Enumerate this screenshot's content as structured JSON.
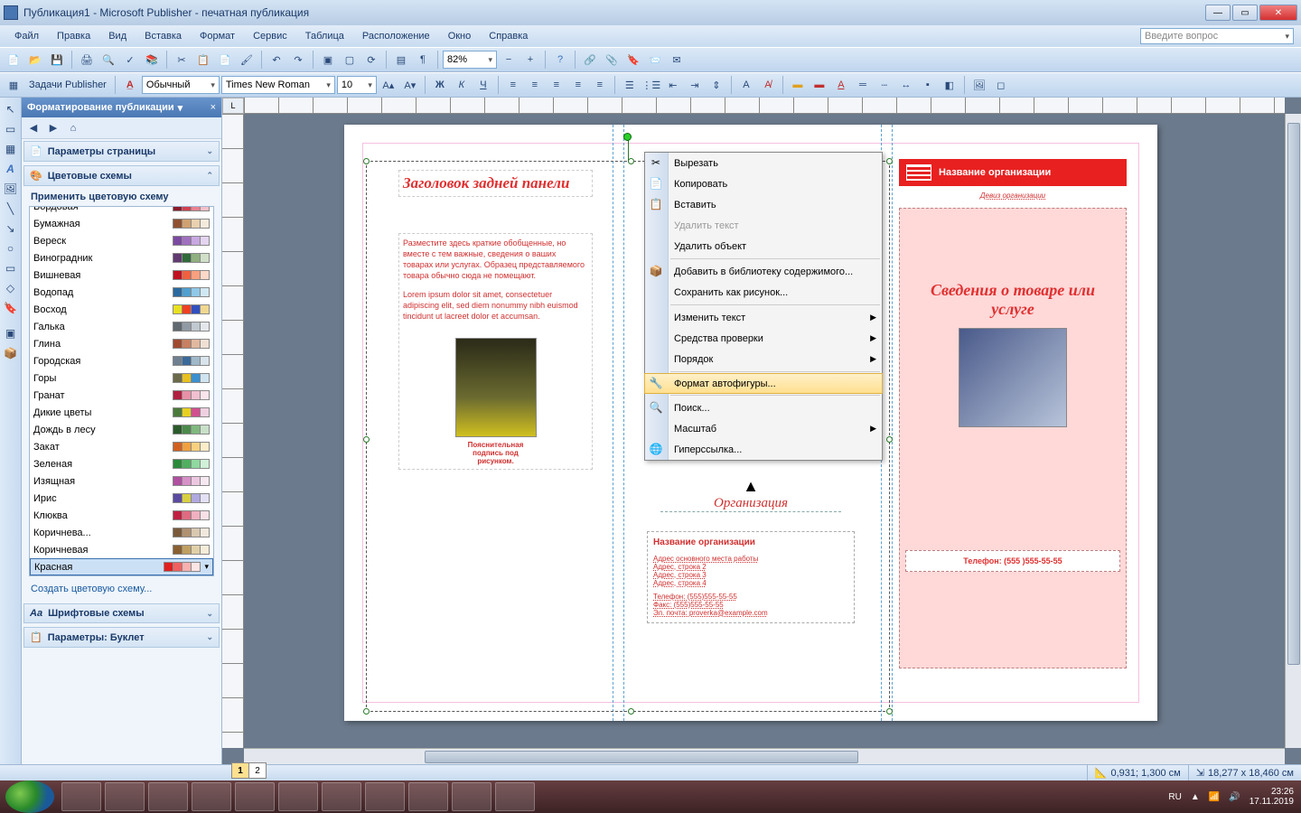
{
  "window": {
    "title": "Публикация1 - Microsoft Publisher - печатная публикация"
  },
  "menu": {
    "items": [
      "Файл",
      "Правка",
      "Вид",
      "Вставка",
      "Формат",
      "Сервис",
      "Таблица",
      "Расположение",
      "Окно",
      "Справка"
    ],
    "ask": "Введите вопрос"
  },
  "toolbar2": {
    "tasks_label": "Задачи Publisher",
    "style": "Обычный",
    "font": "Times New Roman",
    "size": "10",
    "zoom": "82%"
  },
  "taskpane": {
    "title": "Форматирование публикации",
    "sec_page": "Параметры страницы",
    "sec_color": "Цветовые схемы",
    "apply_label": "Применить цветовую схему",
    "schemes": [
      {
        "name": "Бордовая",
        "c": [
          "#8a1a2a",
          "#d04050",
          "#e88090",
          "#f4c0c8"
        ]
      },
      {
        "name": "Бумажная",
        "c": [
          "#905030",
          "#d0a070",
          "#e8d0b0",
          "#f4eadc"
        ]
      },
      {
        "name": "Вереск",
        "c": [
          "#7a4aa0",
          "#a070c0",
          "#c8a8e0",
          "#e4d4f0"
        ]
      },
      {
        "name": "Виноградник",
        "c": [
          "#603a70",
          "#306a3a",
          "#90b080",
          "#d0e0c8"
        ]
      },
      {
        "name": "Вишневая",
        "c": [
          "#c01020",
          "#f06040",
          "#f8a080",
          "#fcd8c8"
        ]
      },
      {
        "name": "Водопад",
        "c": [
          "#2a6aa0",
          "#50a0d0",
          "#90c8e8",
          "#d0e8f4"
        ]
      },
      {
        "name": "Восход",
        "c": [
          "#e8e020",
          "#f04020",
          "#3050c0",
          "#f0d890"
        ]
      },
      {
        "name": "Галька",
        "c": [
          "#606870",
          "#909aa4",
          "#c0c8d0",
          "#e4e8ec"
        ]
      },
      {
        "name": "Глина",
        "c": [
          "#a04a30",
          "#c88060",
          "#e0b8a0",
          "#f0e0d4"
        ]
      },
      {
        "name": "Городская",
        "c": [
          "#708090",
          "#3a6a9a",
          "#a0b8c8",
          "#d8e4ec"
        ]
      },
      {
        "name": "Горы",
        "c": [
          "#6a6a4a",
          "#e8c020",
          "#3a90d0",
          "#d0e4f0"
        ]
      },
      {
        "name": "Гранат",
        "c": [
          "#b02040",
          "#e890a8",
          "#f0c0d0",
          "#f8e4ea"
        ]
      },
      {
        "name": "Дикие цветы",
        "c": [
          "#4a7a3a",
          "#e8d020",
          "#d05090",
          "#f0d0e0"
        ]
      },
      {
        "name": "Дождь в лесу",
        "c": [
          "#2a5a2a",
          "#4a8a4a",
          "#80b880",
          "#c8e0c8"
        ]
      },
      {
        "name": "Закат",
        "c": [
          "#d06020",
          "#f0a040",
          "#f8d080",
          "#fcecc8"
        ]
      },
      {
        "name": "Зеленая",
        "c": [
          "#2a8a3a",
          "#50b060",
          "#90d8a0",
          "#d0f0d8"
        ]
      },
      {
        "name": "Изящная",
        "c": [
          "#b050a0",
          "#d890c8",
          "#ecc8e0",
          "#f6e8f0"
        ]
      },
      {
        "name": "Ирис",
        "c": [
          "#5a4aa0",
          "#d8d040",
          "#b0a8e0",
          "#e4e0f4"
        ]
      },
      {
        "name": "Клюква",
        "c": [
          "#c02040",
          "#e06a80",
          "#f0b0c0",
          "#f8e0e6"
        ]
      },
      {
        "name": "Коричнева...",
        "c": [
          "#7a5a3a",
          "#b09070",
          "#d8c8b0",
          "#f0e8dc"
        ]
      },
      {
        "name": "Коричневая",
        "c": [
          "#8a6030",
          "#c0a060",
          "#e0d0a8",
          "#f4ecd8"
        ]
      },
      {
        "name": "Красная",
        "c": [
          "#e02020",
          "#f06060",
          "#f8b0b0",
          "#fce4e4"
        ]
      }
    ],
    "selected_scheme": "Красная",
    "create_link": "Создать цветовую схему...",
    "sec_font": "Шрифтовые схемы",
    "sec_params": "Параметры: Буклет"
  },
  "ruler_corner": "L",
  "doc": {
    "panel1_title": "Заголовок задней панели",
    "panel1_body1": "Разместите здесь краткие обобщенные, но вместе с тем важные, сведения о ваших товарах или услугах. Образец представляемого товара обычно сюда не помещают.",
    "panel1_body2": "Lorem ipsum dolor sit amet, consectetuer adipiscing elit, sed diem nonummy nibh euismod tincidunt ut lacreet dolor et accumsan.",
    "panel1_caption": "Пояснительная подпись под рисунком.",
    "org_label": "Организация",
    "org_name": "Название организации",
    "org_addr": [
      "Адрес основного места работы",
      "Адрес, строка 2",
      "Адрес, строка 3",
      "Адрес, строка 4"
    ],
    "org_tel": "Телефон: (555)555-55-55",
    "org_fax": "Факс: (555)555-55-55",
    "org_email": "Эл. почта: proverka@example.com",
    "panel3_org": "Название организации",
    "panel3_slogan": "Девиз организации",
    "panel3_title": "Сведения о товаре или услуге",
    "panel3_phone": "Телефон: (555 )555-55-55"
  },
  "context_menu": {
    "items": [
      {
        "label": "Вырезать",
        "icon": "✂"
      },
      {
        "label": "Копировать",
        "icon": "📄"
      },
      {
        "label": "Вставить",
        "icon": "📋"
      },
      {
        "label": "Удалить текст",
        "disabled": true
      },
      {
        "label": "Удалить объект"
      },
      {
        "sep": true
      },
      {
        "label": "Добавить в библиотеку содержимого...",
        "icon": "📦"
      },
      {
        "label": "Сохранить как рисунок..."
      },
      {
        "sep": true
      },
      {
        "label": "Изменить текст",
        "arrow": true
      },
      {
        "label": "Средства проверки",
        "arrow": true
      },
      {
        "label": "Порядок",
        "arrow": true
      },
      {
        "sep": true
      },
      {
        "label": "Формат автофигуры...",
        "icon": "🔧",
        "hover": true
      },
      {
        "sep": true
      },
      {
        "label": "Поиск...",
        "icon": "🔍"
      },
      {
        "label": "Масштаб",
        "arrow": true
      },
      {
        "label": "Гиперссылка...",
        "icon": "🌐"
      }
    ]
  },
  "status": {
    "pages": [
      "1",
      "2"
    ],
    "pos": "0,931; 1,300 см",
    "size": "18,277 x 18,460 см"
  },
  "tray": {
    "lang": "RU",
    "time": "23:26",
    "date": "17.11.2019"
  }
}
